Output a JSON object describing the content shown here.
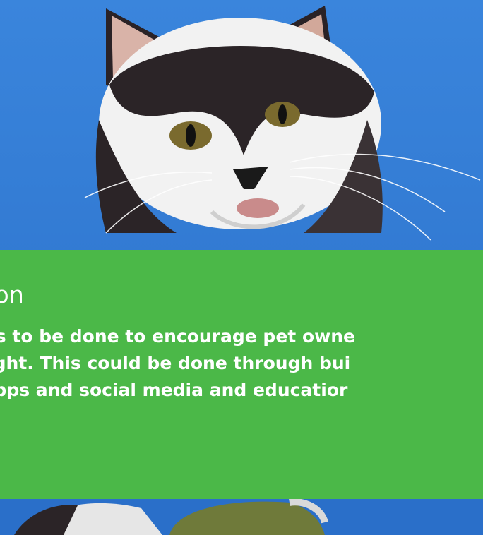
{
  "hero": {
    "image_subject": "cat-photo",
    "sky_color": "#2f7fd6"
  },
  "card": {
    "background_color": "#4bb848",
    "title": "tion",
    "body_lines": [
      "eeds to be done to encourage pet owne",
      "weight. This could be done through bui",
      "y, apps and social media and educatior"
    ]
  }
}
